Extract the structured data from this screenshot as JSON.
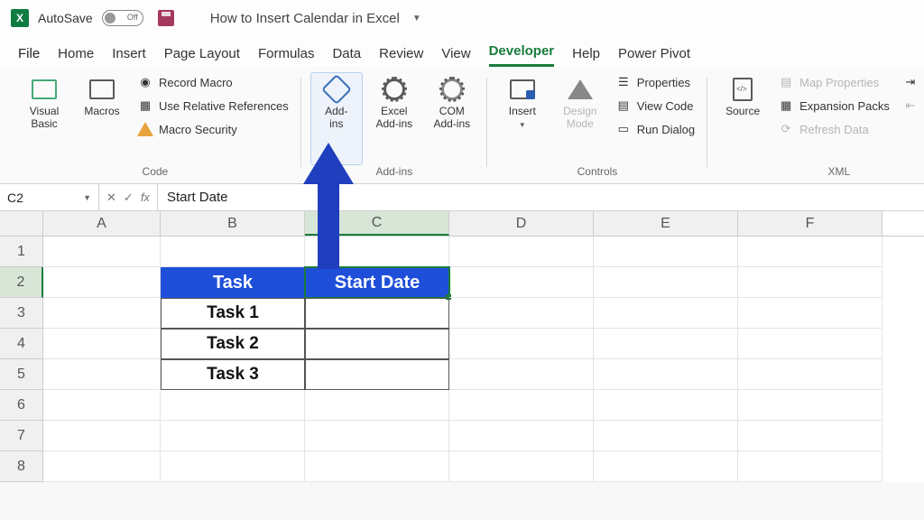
{
  "titlebar": {
    "autosave_label": "AutoSave",
    "autosave_state": "Off",
    "doc_title": "How to Insert Calendar in Excel"
  },
  "tabs": [
    "File",
    "Home",
    "Insert",
    "Page Layout",
    "Formulas",
    "Data",
    "Review",
    "View",
    "Developer",
    "Help",
    "Power Pivot"
  ],
  "active_tab": "Developer",
  "ribbon": {
    "code": {
      "label": "Code",
      "visual_basic": "Visual\nBasic",
      "macros": "Macros",
      "record_macro": "Record Macro",
      "use_relative": "Use Relative References",
      "macro_security": "Macro Security"
    },
    "addins": {
      "label": "Add-ins",
      "addins": "Add-\nins",
      "excel_addins": "Excel\nAdd-ins",
      "com_addins": "COM\nAdd-ins"
    },
    "controls": {
      "label": "Controls",
      "insert": "Insert",
      "design_mode": "Design\nMode",
      "properties": "Properties",
      "view_code": "View Code",
      "run_dialog": "Run Dialog"
    },
    "xml": {
      "label": "XML",
      "source": "Source",
      "map_properties": "Map Properties",
      "expansion_packs": "Expansion Packs",
      "refresh_data": "Refresh Data",
      "import": "Import",
      "export": "Export"
    }
  },
  "formula_bar": {
    "name_box": "C2",
    "value": "Start Date"
  },
  "columns": [
    "A",
    "B",
    "C",
    "D",
    "E",
    "F"
  ],
  "selected_column": "C",
  "selected_row": "2",
  "row_count": 8,
  "table": {
    "header": [
      "Task",
      "Start Date"
    ],
    "rows": [
      "Task 1",
      "Task 2",
      "Task 3"
    ]
  },
  "chart_data": null
}
